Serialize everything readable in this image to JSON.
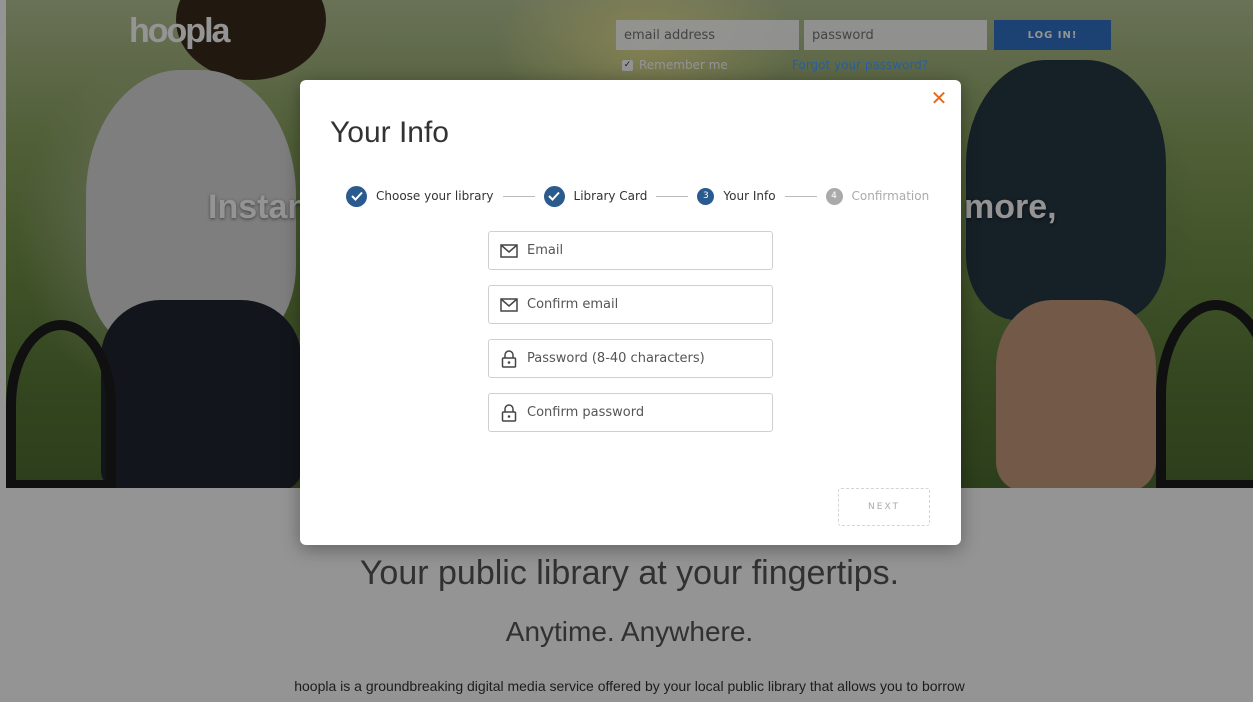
{
  "header": {
    "logo": "hoopla",
    "email_placeholder": "email address",
    "password_placeholder": "password",
    "login_label": "LOG IN!",
    "remember_label": "Remember me",
    "forgot_label": "Forgot your password?"
  },
  "hero": {
    "text_left": "Instan",
    "text_right": "more,"
  },
  "lower": {
    "tagline": "Your public library at your fingertips.",
    "tagline2": "Anytime. Anywhere.",
    "description": "hoopla is a groundbreaking digital media service offered by your local public library that allows you to borrow"
  },
  "modal": {
    "title": "Your Info",
    "close_symbol": "✕",
    "steps": [
      {
        "label": "Choose your library",
        "state": "done"
      },
      {
        "label": "Library Card",
        "state": "done"
      },
      {
        "label": "Your Info",
        "state": "current",
        "number": "3"
      },
      {
        "label": "Confirmation",
        "state": "todo",
        "number": "4"
      }
    ],
    "fields": {
      "email_placeholder": "Email",
      "confirm_email_placeholder": "Confirm email",
      "password_placeholder": "Password (8-40 characters)",
      "confirm_password_placeholder": "Confirm password"
    },
    "next_label": "NEXT"
  },
  "colors": {
    "accent_blue": "#2a5a8e",
    "close_orange": "#e76a1b",
    "login_blue": "#2f73c5"
  }
}
